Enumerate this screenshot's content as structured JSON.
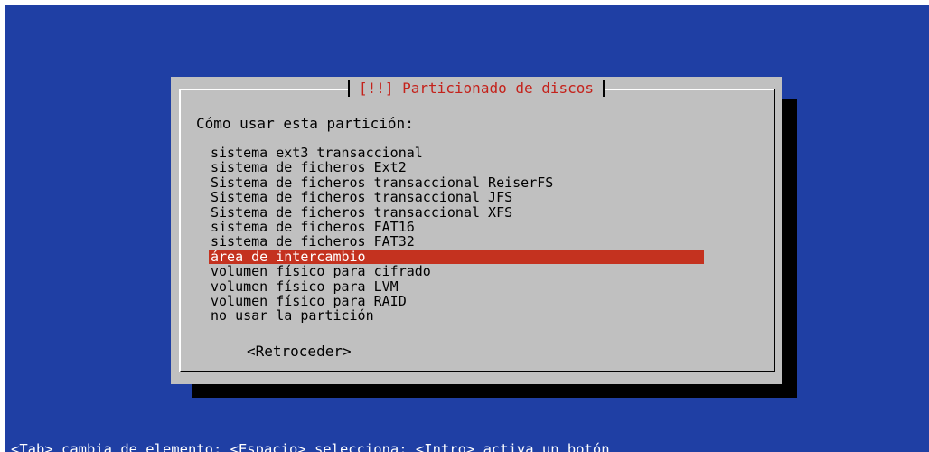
{
  "dialog": {
    "title": "[!!] Particionado de discos",
    "prompt": "Cómo usar esta partición:",
    "options": [
      {
        "label": "sistema ext3 transaccional"
      },
      {
        "label": "sistema de ficheros Ext2"
      },
      {
        "label": "Sistema de ficheros transaccional ReiserFS"
      },
      {
        "label": "Sistema de ficheros transaccional JFS"
      },
      {
        "label": "Sistema de ficheros transaccional XFS"
      },
      {
        "label": "sistema de ficheros FAT16"
      },
      {
        "label": "sistema de ficheros FAT32"
      },
      {
        "label": "área de intercambio",
        "selected": true
      },
      {
        "label": "volumen físico para cifrado"
      },
      {
        "label": "volumen físico para LVM"
      },
      {
        "label": "volumen físico para RAID"
      },
      {
        "label": "no usar la partición"
      }
    ],
    "back_label": "<Retroceder>"
  },
  "help_line": "<Tab> cambia de elemento; <Espacio> selecciona; <Intro> activa un botón",
  "colors": {
    "background": "#1f3fa4",
    "dialog": "#c0c0c0",
    "title": "#c4221b",
    "selection": "#c4321f",
    "shadow": "#000000"
  }
}
